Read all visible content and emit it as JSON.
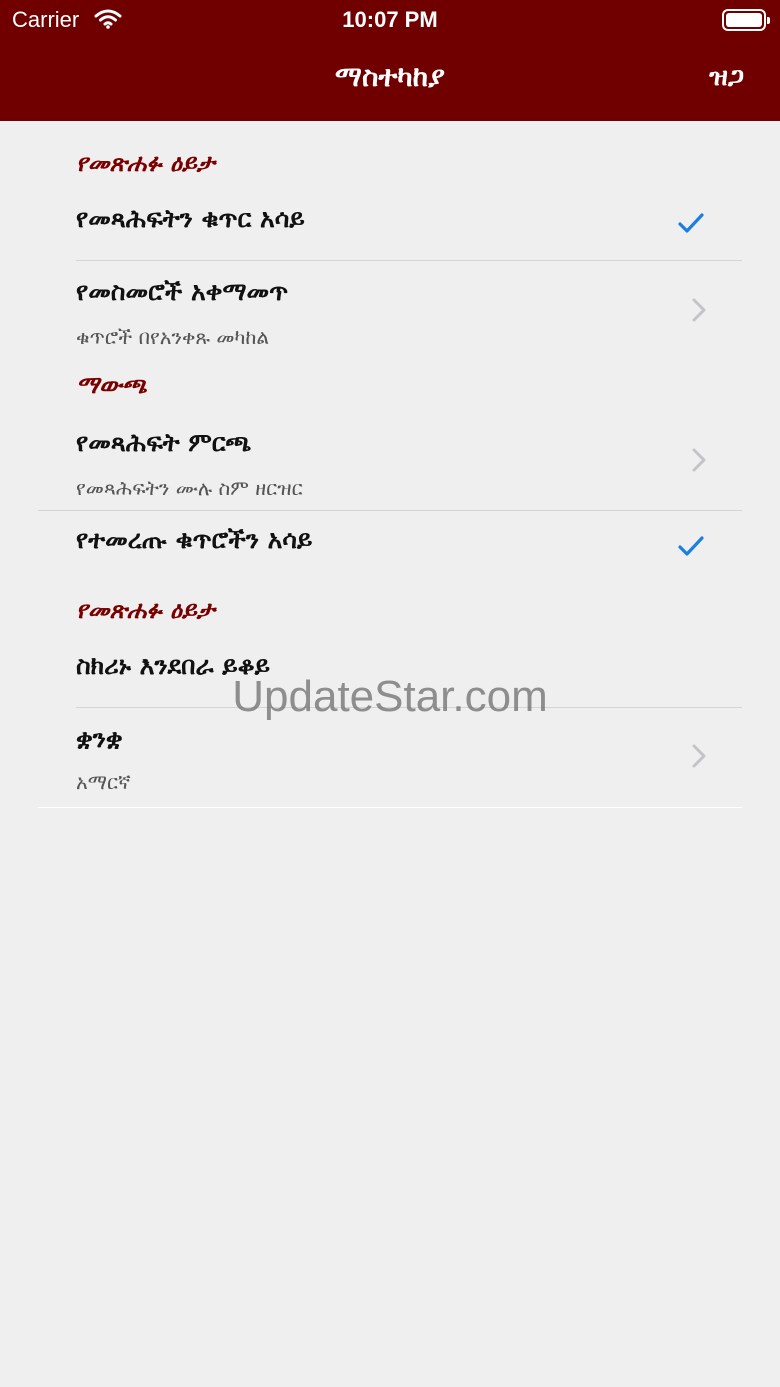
{
  "status_bar": {
    "carrier": "Carrier",
    "time": "10:07 PM"
  },
  "nav": {
    "title": "ማስተካከያ",
    "right_button": "ዝጋ"
  },
  "sections": [
    {
      "header": "የመጽሐፉ ዕይታ",
      "rows": [
        {
          "title": "የመጻሕፍትን ቁጥር አሳይ",
          "accessory": "checkmark"
        },
        {
          "title": "የመስመሮች አቀማመጥ",
          "subtitle": "ቁጥሮች በየአንቀጹ መካከል",
          "accessory": "chevron"
        }
      ]
    },
    {
      "header": "ማውጫ",
      "rows": [
        {
          "title": "የመጻሕፍት ምርጫ",
          "subtitle": "የመጻሕፍትን ሙሉ ስም ዘርዝር",
          "accessory": "chevron"
        },
        {
          "title": "የተመረጡ ቁጥሮችን አሳይ",
          "accessory": "checkmark"
        }
      ]
    },
    {
      "header": "የመጽሐፉ ዕይታ",
      "rows": [
        {
          "title": "ስክሪኑ እንደበራ ይቆይ",
          "accessory": "none"
        },
        {
          "title": "ቋንቋ",
          "subtitle": "አማርኛ",
          "accessory": "chevron"
        }
      ]
    }
  ],
  "watermark": "UpdateStar.com",
  "colors": {
    "nav_bg": "#700000",
    "section_header": "#7a0000",
    "check": "#1a7fe0",
    "page_bg": "#efefef"
  }
}
